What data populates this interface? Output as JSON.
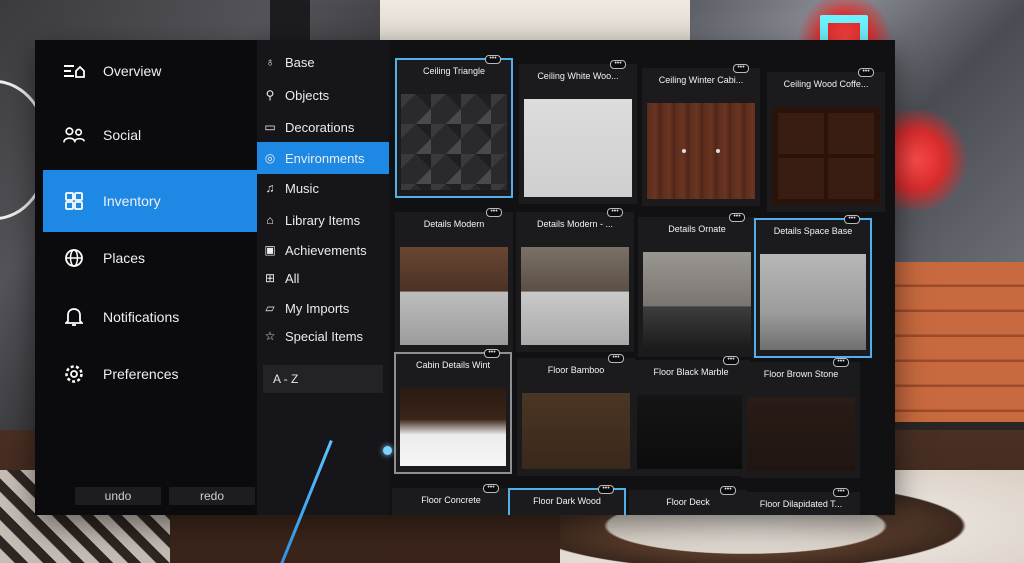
{
  "sidebar": {
    "items": [
      {
        "label": "Overview",
        "icon": "overview-icon"
      },
      {
        "label": "Social",
        "icon": "social-icon"
      },
      {
        "label": "Inventory",
        "icon": "inventory-icon",
        "active": true
      },
      {
        "label": "Places",
        "icon": "globe-icon"
      },
      {
        "label": "Notifications",
        "icon": "bell-icon"
      },
      {
        "label": "Preferences",
        "icon": "gear-icon"
      }
    ],
    "undo_label": "undo",
    "redo_label": "redo"
  },
  "categories": {
    "items": [
      {
        "label": "Base",
        "icon": "base-icon"
      },
      {
        "label": "Objects",
        "icon": "objects-icon"
      },
      {
        "label": "Decorations",
        "icon": "decorations-icon"
      },
      {
        "label": "Environments",
        "icon": "environments-icon",
        "active": true
      },
      {
        "label": "Music",
        "icon": "music-icon"
      },
      {
        "label": "Library Items",
        "icon": "library-icon"
      },
      {
        "label": "Achievements",
        "icon": "achievements-icon"
      },
      {
        "label": "All",
        "icon": "grid-icon"
      },
      {
        "label": "My Imports",
        "icon": "folder-icon"
      },
      {
        "label": "Special Items",
        "icon": "star-icon"
      }
    ],
    "sort_label": "A - Z"
  },
  "tiles": [
    {
      "name": "Ceiling Triangle",
      "selected": true
    },
    {
      "name": "Ceiling White Woo..."
    },
    {
      "name": "Ceiling Winter Cabi..."
    },
    {
      "name": "Ceiling Wood Coffe..."
    },
    {
      "name": "Details Modern"
    },
    {
      "name": "Details Modern - ..."
    },
    {
      "name": "Details Ornate"
    },
    {
      "name": "Details Space Base",
      "selected": true
    },
    {
      "name": "Cabin   Details Wint"
    },
    {
      "name": "Floor Bamboo"
    },
    {
      "name": "Floor Black Marble"
    },
    {
      "name": "Floor Brown Stone"
    },
    {
      "name": "Floor Concrete"
    },
    {
      "name": "Floor Dark Wood",
      "selected": true
    },
    {
      "name": "Floor Deck"
    },
    {
      "name": "Floor Dilapidated T..."
    }
  ],
  "tile_menu_glyph": "•••",
  "colors": {
    "accent": "#1e88e5",
    "selection": "#4fb0ea",
    "panel": "#111113"
  }
}
